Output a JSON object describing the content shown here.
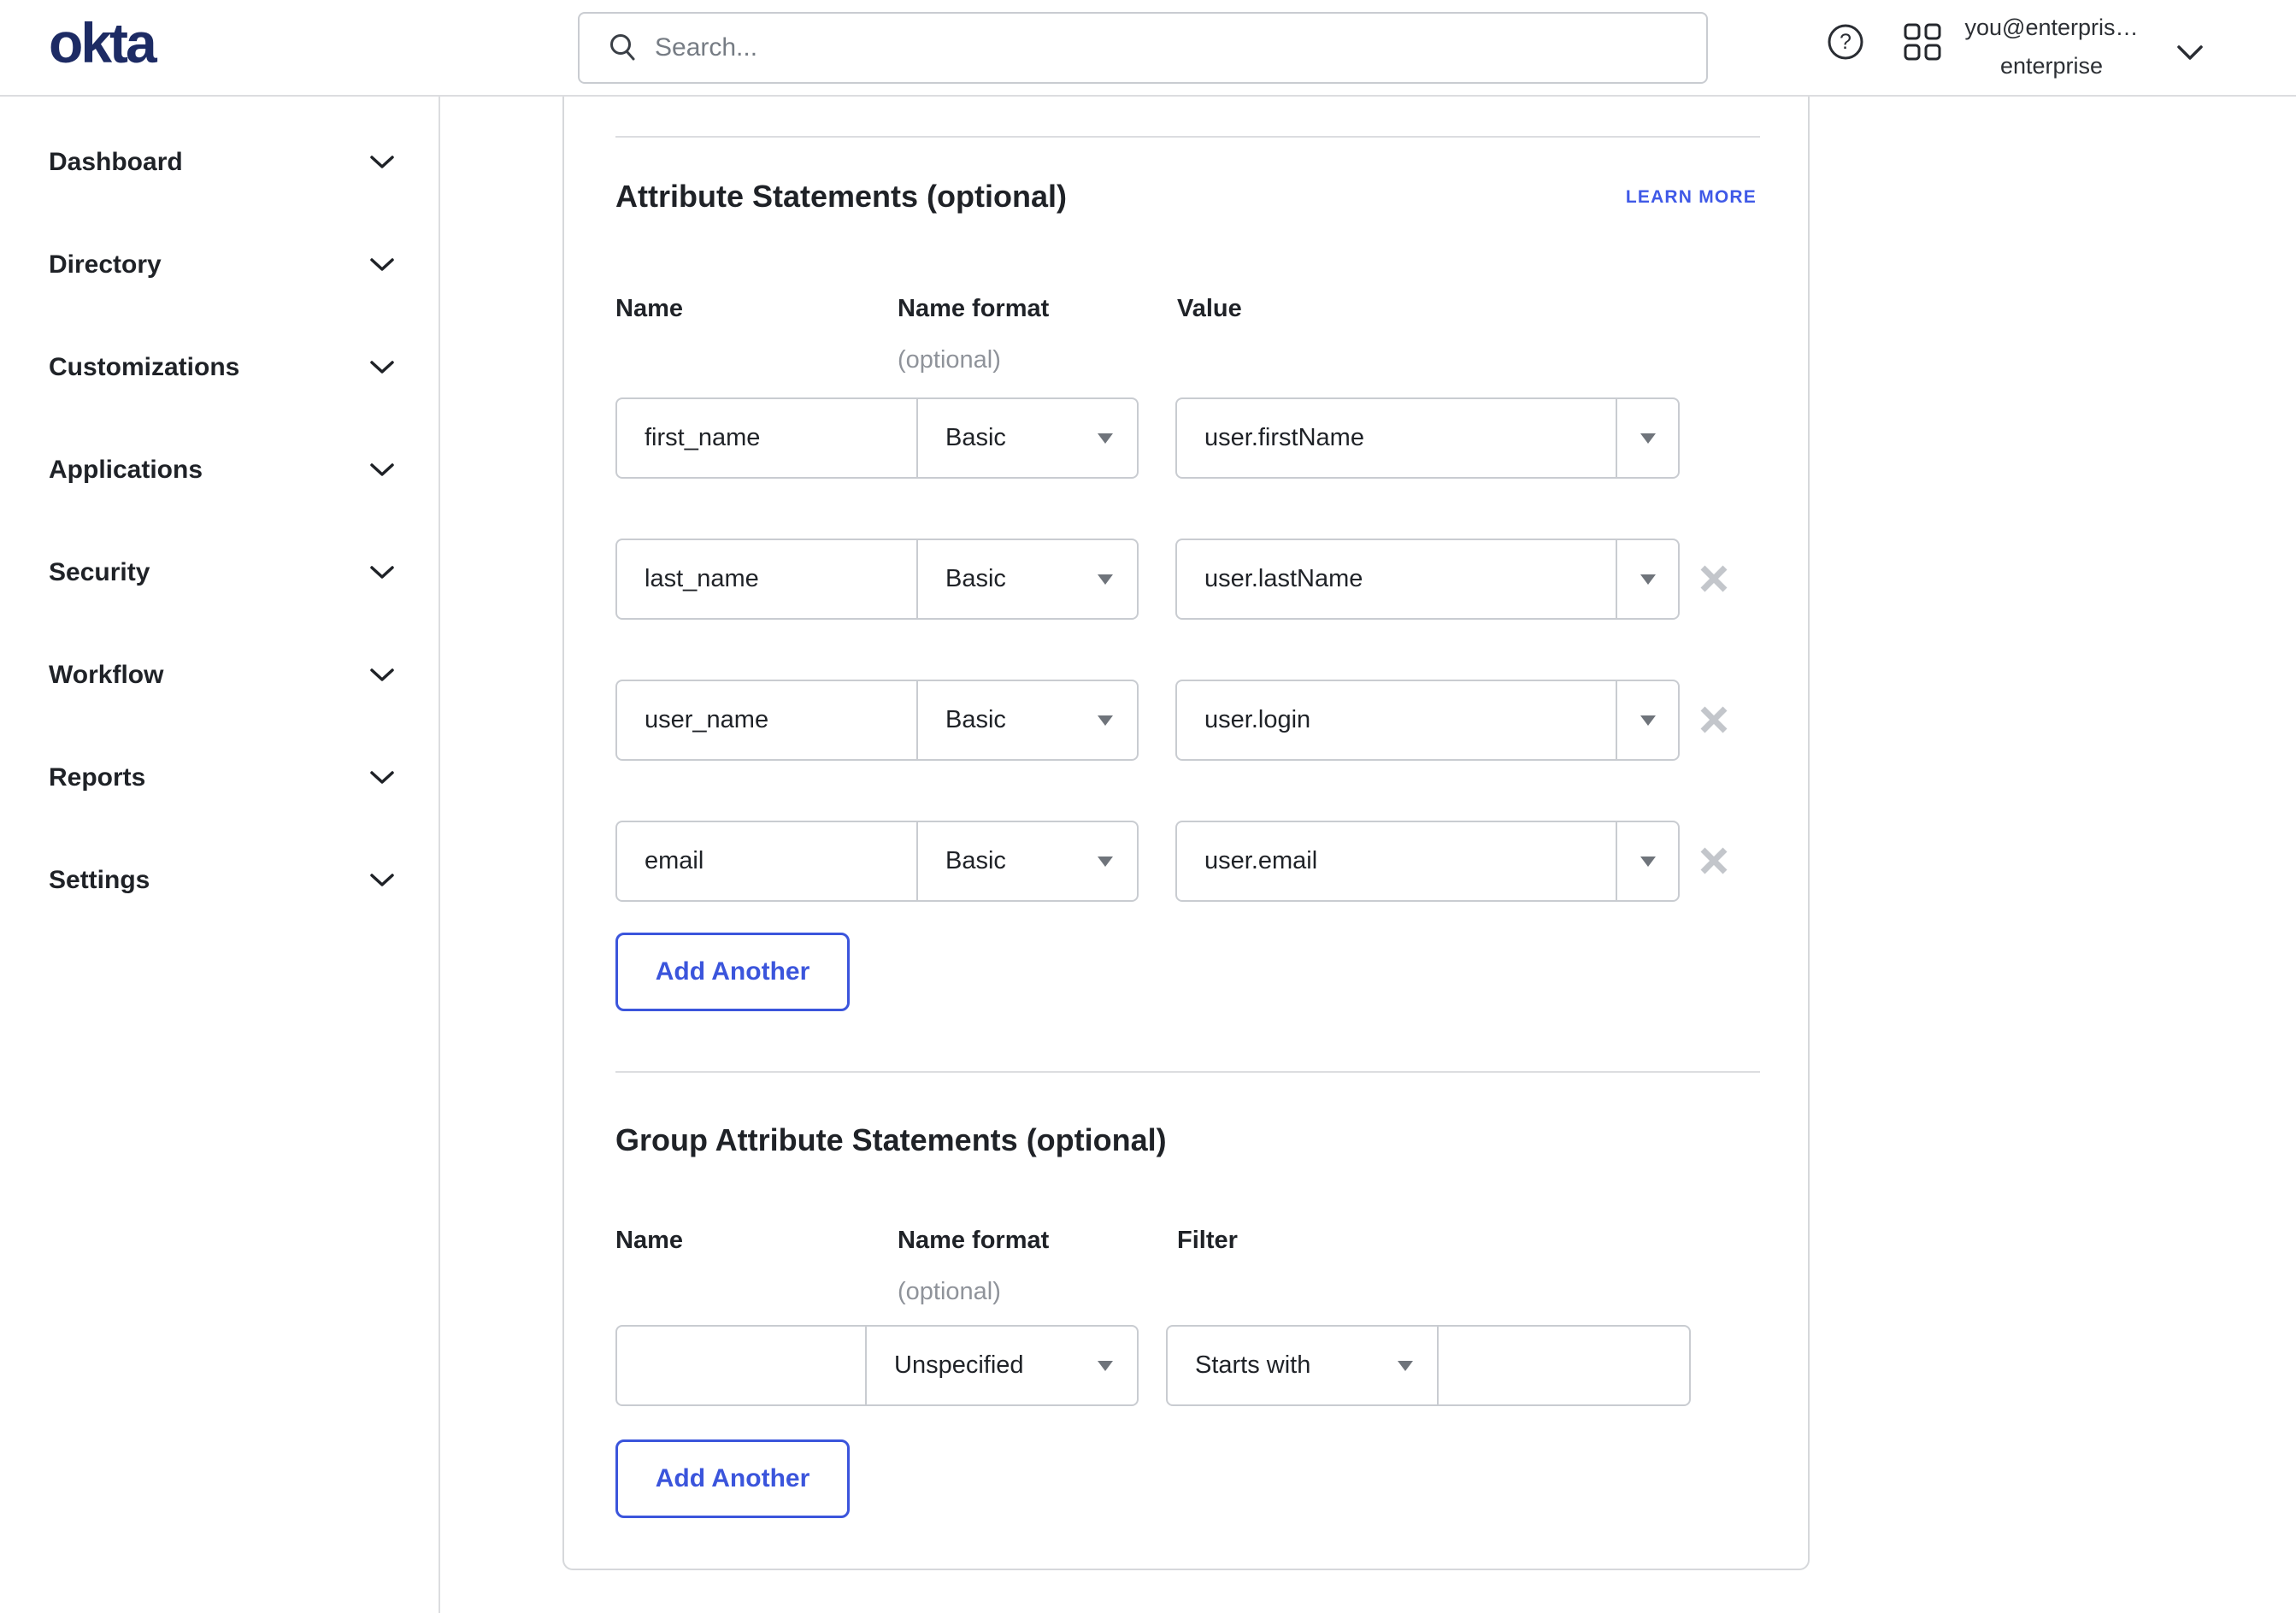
{
  "topbar": {
    "logo": "okta",
    "search_placeholder": "Search...",
    "account_line1": "you@enterpris…",
    "account_line2": "enterprise",
    "icons": [
      "help-icon",
      "apps-grid-icon",
      "chevron-down-icon"
    ]
  },
  "sidebar": {
    "items": [
      {
        "label": "Dashboard"
      },
      {
        "label": "Directory"
      },
      {
        "label": "Customizations"
      },
      {
        "label": "Applications"
      },
      {
        "label": "Security"
      },
      {
        "label": "Workflow"
      },
      {
        "label": "Reports"
      },
      {
        "label": "Settings"
      }
    ]
  },
  "attribute_section": {
    "title": "Attribute Statements (optional)",
    "learn_more": "LEARN MORE",
    "columns": {
      "name": "Name",
      "name_format": "Name format",
      "name_format_note": "(optional)",
      "value": "Value"
    },
    "rows": [
      {
        "name": "first_name",
        "format": "Basic",
        "value": "user.firstName",
        "removable": false
      },
      {
        "name": "last_name",
        "format": "Basic",
        "value": "user.lastName",
        "removable": true
      },
      {
        "name": "user_name",
        "format": "Basic",
        "value": "user.login",
        "removable": true
      },
      {
        "name": "email",
        "format": "Basic",
        "value": "user.email",
        "removable": true
      }
    ],
    "add_button": "Add Another"
  },
  "group_section": {
    "title": "Group Attribute Statements (optional)",
    "columns": {
      "name": "Name",
      "name_format": "Name format",
      "name_format_note": "(optional)",
      "filter": "Filter"
    },
    "row": {
      "name_value": "",
      "format": "Unspecified",
      "filter_type": "Starts with",
      "filter_value": ""
    },
    "add_button": "Add Another"
  },
  "colors": {
    "logo_navy": "#1d2b64",
    "link_blue": "#3f59e7",
    "button_blue": "#3b55dc",
    "text_dark": "#1f2227",
    "text_gray": "#8f939a",
    "border_gray": "#c9ccd1"
  }
}
